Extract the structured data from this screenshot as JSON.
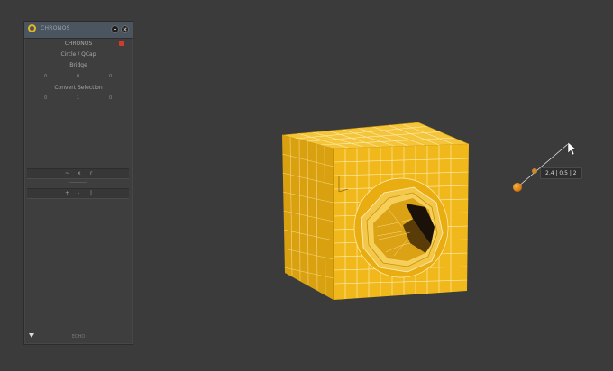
{
  "panel": {
    "title": "CHRONOS",
    "header": "CHRONOS",
    "section1_label": "Circle / QCap",
    "section2_label": "Bridge",
    "section2_values": [
      "0",
      "0",
      "0"
    ],
    "section3_label": "Convert Selection",
    "section3_values": [
      "0",
      "1",
      "0"
    ],
    "row1_buttons": [
      "~",
      "x",
      "r"
    ],
    "row2_buttons": [
      "+",
      "-",
      "|"
    ],
    "footer": "ECHO"
  },
  "viewport": {
    "tooltip": "2.4 | 0.5 | 2"
  },
  "colors": {
    "accent": "#e6b623",
    "mesh_yellow": "#f0b81a",
    "background": "#3b3b3b"
  },
  "icons": [
    "logo-icon",
    "minimize-icon",
    "close-icon",
    "collapse-arrow-icon",
    "cursor-arrow-icon",
    "handle-dot-icon"
  ]
}
